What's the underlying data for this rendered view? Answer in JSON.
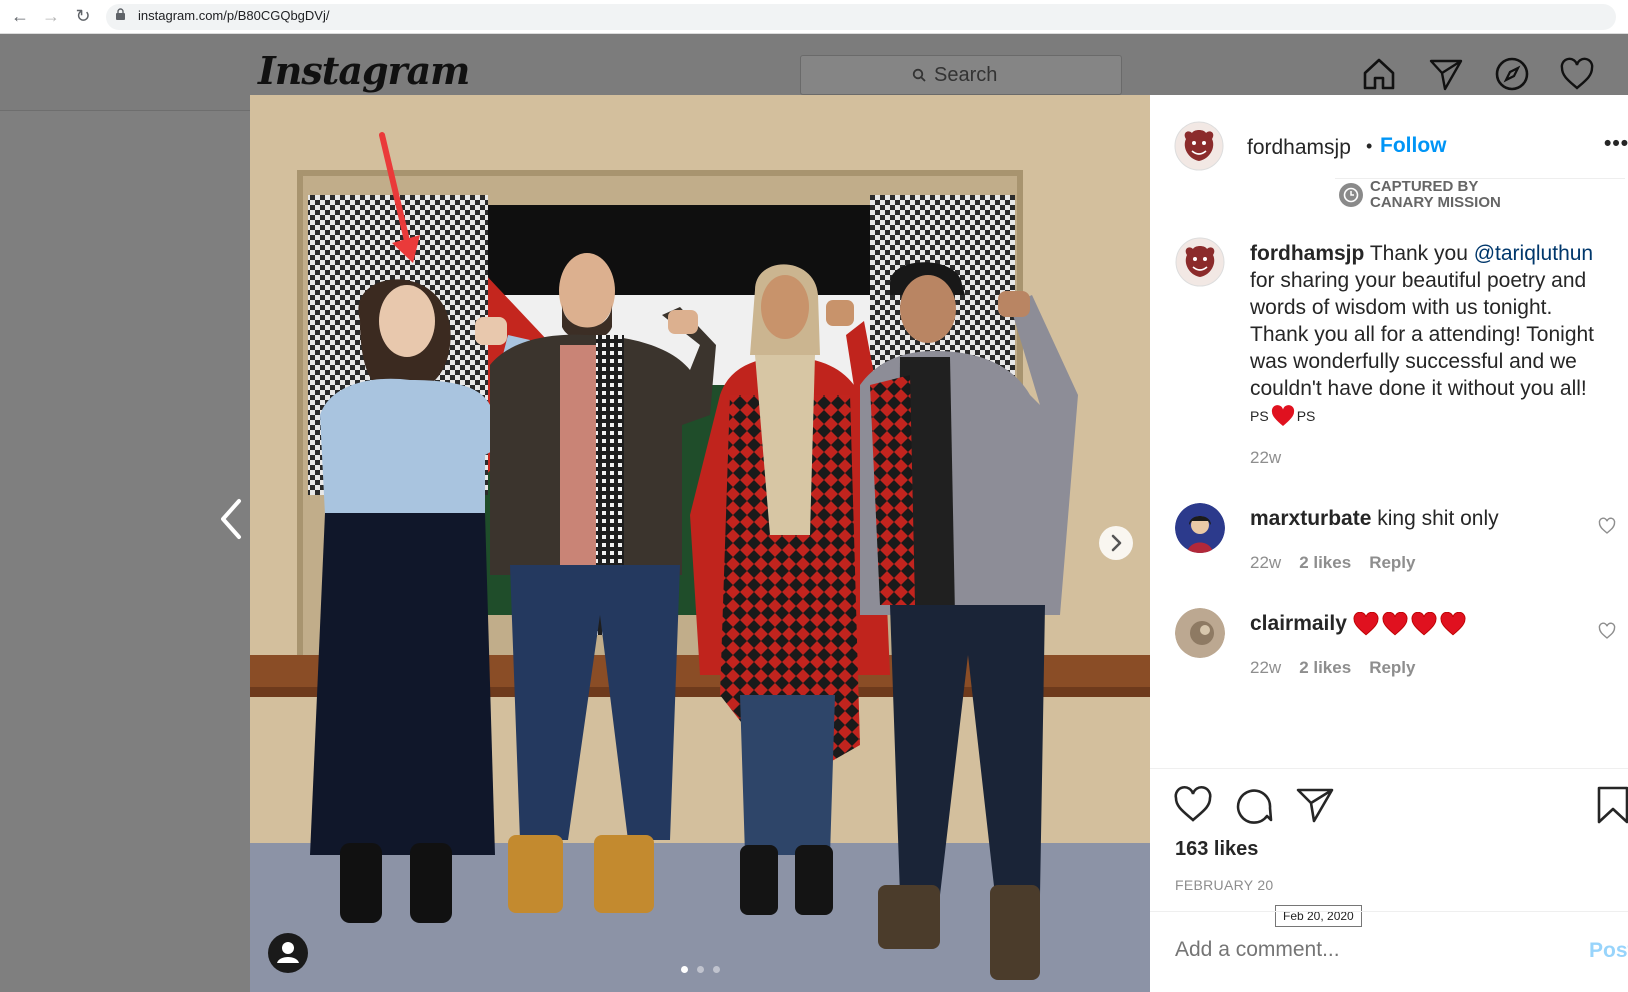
{
  "browser": {
    "url": "instagram.com/p/B80CGQbgDVj/"
  },
  "header": {
    "logo": "Instagram",
    "search_placeholder": "Search"
  },
  "post": {
    "author": "fordhamsjp",
    "follow_separator": "•",
    "follow_label": "Follow",
    "captured_by": [
      "CAPTURED BY",
      "CANARY MISSION"
    ],
    "caption": {
      "username": "fordhamsjp",
      "lines": [
        "Thank you",
        "for sharing your beautiful poetry and",
        "words of wisdom with us tonight.",
        "Thank you all for a attending! Tonight",
        "was wonderfully successful and we",
        "couldn't have done it without you all!"
      ],
      "mention": "@tariqluthun",
      "ps_left": "PS",
      "ps_right": "PS",
      "time": "22w"
    },
    "comments": [
      {
        "username": "marxturbate",
        "text": "king shit only",
        "time": "22w",
        "likes": "2 likes",
        "reply": "Reply"
      },
      {
        "username": "clairmaily",
        "text": "",
        "time": "22w",
        "likes": "2 likes",
        "reply": "Reply"
      }
    ],
    "likes": "163 likes",
    "date": "FEBRUARY 20",
    "date_tooltip": "Feb 20, 2020",
    "comment_placeholder": "Add a comment...",
    "post_button": "Post",
    "carousel_dots": 3
  },
  "colors": {
    "accent": "#0095f6",
    "heart": "#e0111f"
  }
}
